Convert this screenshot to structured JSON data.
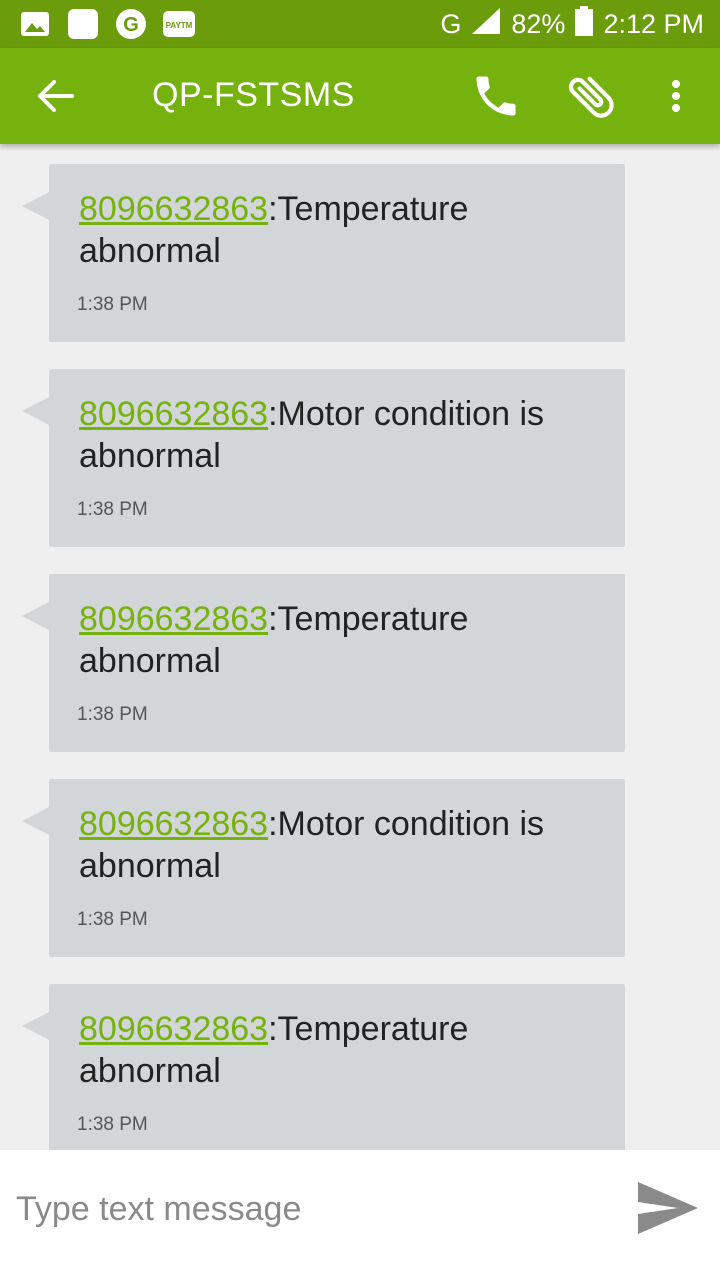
{
  "status_bar": {
    "notification_icons": [
      "gallery-icon",
      "white-square-icon",
      "google-icon",
      "paytm-icon"
    ],
    "network": "G",
    "battery": "82%",
    "time": "2:12 PM"
  },
  "app_bar": {
    "title": "QP-FSTSMS",
    "color": "#76b20e",
    "icons": [
      "back-arrow-icon",
      "phone-icon",
      "paperclip-icon",
      "more-vert-icon"
    ]
  },
  "messages": [
    {
      "number": "8096632863",
      "text": ":Temperature abnormal",
      "time": "1:38 PM"
    },
    {
      "number": "8096632863",
      "text": ":Motor condition is abnormal",
      "time": "1:38 PM"
    },
    {
      "number": "8096632863",
      "text": ":Temperature abnormal",
      "time": "1:38 PM"
    },
    {
      "number": "8096632863",
      "text": ":Motor condition is abnormal",
      "time": "1:38 PM"
    },
    {
      "number": "8096632863",
      "text": ":Temperature abnormal",
      "time": "1:38 PM"
    }
  ],
  "composer": {
    "placeholder": "Type text message"
  }
}
